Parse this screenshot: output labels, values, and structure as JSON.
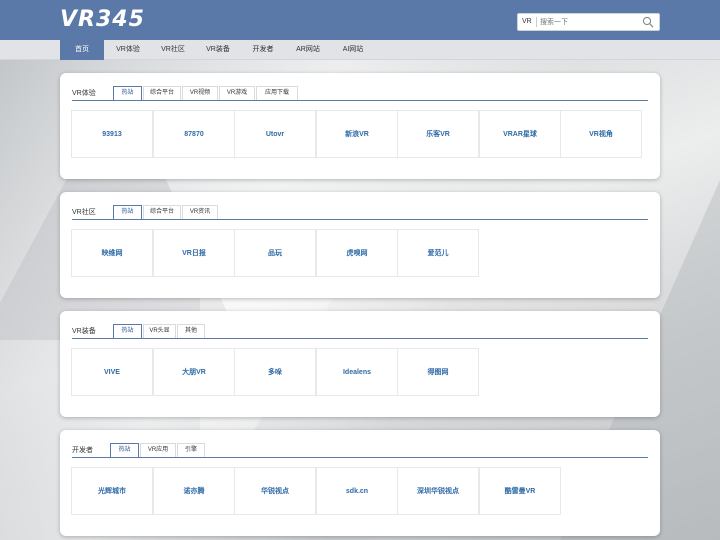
{
  "header": {
    "logo": "VR345",
    "search_prefix": "VR",
    "search_placeholder": "搜索一下"
  },
  "nav": [
    "首页",
    "VR体验",
    "VR社区",
    "VR装备",
    "开发者",
    "AR网站",
    "AI网站"
  ],
  "sections": [
    {
      "title": "VR体验",
      "tabs": [
        "热站",
        "综合平台",
        "VR视频",
        "VR游戏",
        "应用下载"
      ],
      "links": [
        "93913",
        "87870",
        "Utovr",
        "新浪VR",
        "乐客VR",
        "VRAR星球",
        "VR视角"
      ]
    },
    {
      "title": "VR社区",
      "tabs": [
        "热站",
        "综合平台",
        "VR资讯"
      ],
      "links": [
        "映维网",
        "VR日报",
        "品玩",
        "虎嗅网",
        "爱范儿"
      ]
    },
    {
      "title": "VR装备",
      "tabs": [
        "热站",
        "VR头显",
        "其他"
      ],
      "links": [
        "VIVE",
        "大朋VR",
        "多哚",
        "Idealens",
        "得图网"
      ]
    },
    {
      "title": "开发者",
      "tabs": [
        "热站",
        "VR应用",
        "引擎"
      ],
      "links": [
        "光辉城市",
        "诺亦腾",
        "华锐视点",
        "sdk.cn",
        "深圳华锐视点",
        "酷雷曼VR"
      ]
    }
  ],
  "colors": {
    "header_bg": "#5b79a8",
    "link": "#2f6aa6",
    "nav_bg": "#e1e3e6"
  }
}
